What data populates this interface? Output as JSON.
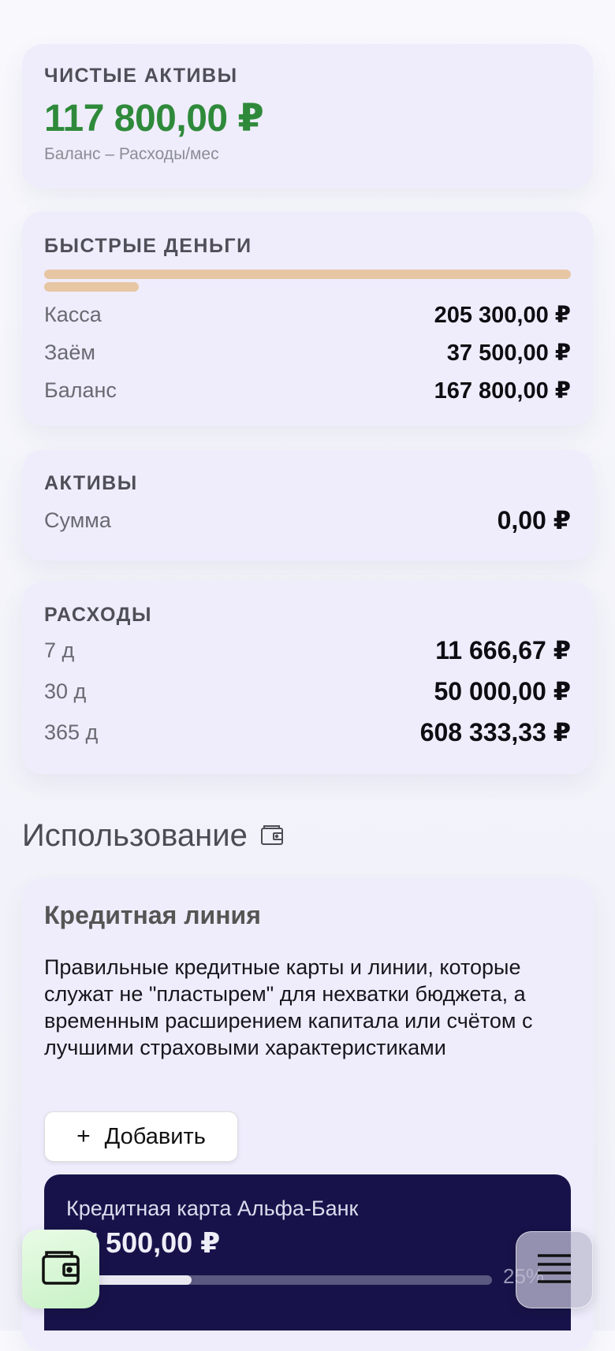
{
  "net_assets": {
    "title": "ЧИСТЫЕ АКТИВЫ",
    "value": "117 800,00 ₽",
    "subtitle": "Баланс – Расходы/мес",
    "color": "#2e8a3a"
  },
  "quick_money": {
    "title": "БЫСТРЫЕ ДЕНЬГИ",
    "rows": [
      {
        "label": "Касса",
        "value": "205 300,00 ₽"
      },
      {
        "label": "Заём",
        "value": "37 500,00 ₽"
      },
      {
        "label": "Баланс",
        "value": "167 800,00 ₽"
      }
    ],
    "bar_color": "#e7c6a4",
    "cash_ratio": 1.0,
    "loan_ratio": 0.18
  },
  "assets": {
    "title": "АКТИВЫ",
    "rows": [
      {
        "label": "Сумма",
        "value": "0,00 ₽"
      }
    ]
  },
  "expenses": {
    "title": "РАСХОДЫ",
    "rows": [
      {
        "label": "7 д",
        "value": "11 666,67 ₽"
      },
      {
        "label": "30 д",
        "value": "50 000,00 ₽"
      },
      {
        "label": "365 д",
        "value": "608 333,33 ₽"
      }
    ]
  },
  "usage": {
    "heading": "Использование",
    "icon": "wallet-icon"
  },
  "credit_line": {
    "title": "Кредитная линия",
    "description": "Правильные кредитные карты и линии, которые служат не \"пластырем\" для нехватки бюджета, а временным расширением капитала или счётом с лучшими страховыми характеристиками",
    "add_button": {
      "icon": "plus-icon",
      "label": "Добавить"
    },
    "card": {
      "name": "Кредитная карта Альфа-Банк",
      "amount": "37 500,00 ₽",
      "percent_label": "25%",
      "progress": 0.25,
      "bg_color": "#17134a"
    }
  },
  "bottom_nav": {
    "left_icon": "wallet-icon",
    "right_icon": "menu-icon"
  }
}
